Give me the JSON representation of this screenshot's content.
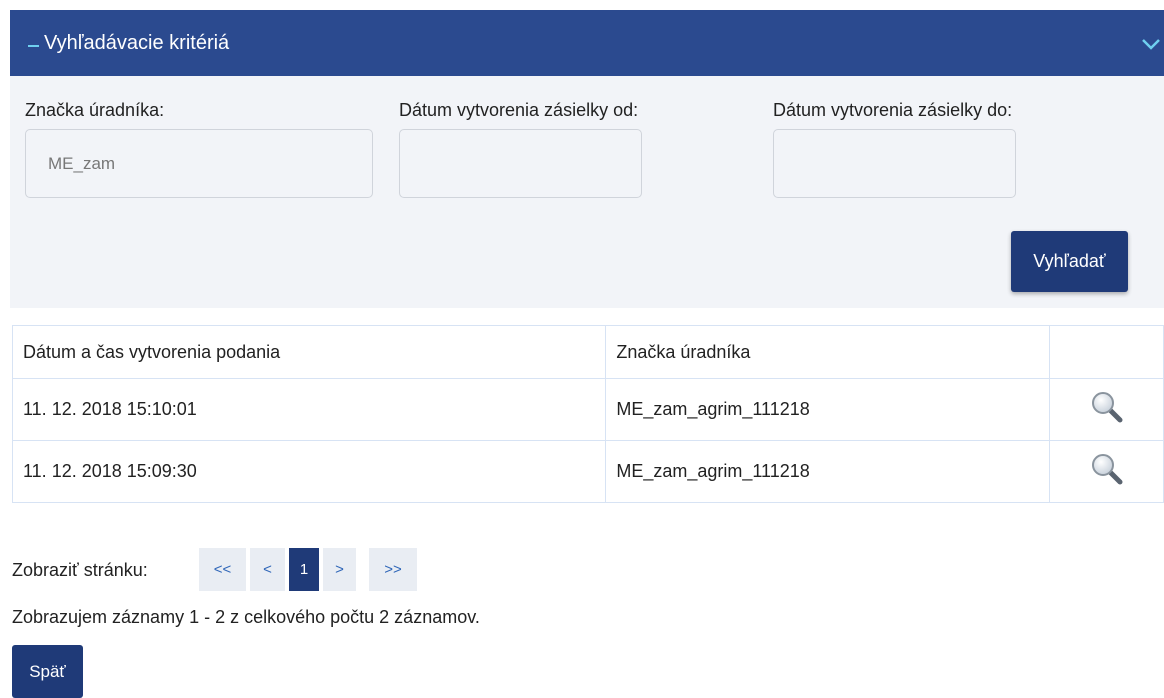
{
  "search_panel": {
    "title": "Vyhľadávacie kritériá",
    "fields": [
      {
        "label": "Značka úradníka:",
        "value": "ME_zam"
      },
      {
        "label": "Dátum vytvorenia zásielky od:",
        "value": ""
      },
      {
        "label": "Dátum vytvorenia zásielky do:",
        "value": ""
      }
    ],
    "search_label": "Vyhľadať"
  },
  "table": {
    "headers": [
      "Dátum a čas vytvorenia podania",
      "Značka úradníka",
      ""
    ],
    "rows": [
      {
        "datetime": "11. 12. 2018 15:10:01",
        "clerk": "ME_zam_agrim_111218"
      },
      {
        "datetime": "11. 12. 2018 15:09:30",
        "clerk": "ME_zam_agrim_111218"
      }
    ]
  },
  "pager": {
    "label": "Zobraziť stránku:",
    "first": "<<",
    "prev": "<",
    "current": "1",
    "next": ">",
    "last": ">>"
  },
  "records_info": "Zobrazujem záznamy 1 - 2 z celkového počtu 2 záznamov.",
  "back_label": "Späť",
  "colors": {
    "header_bg": "#2b4a8f",
    "button_bg": "#1f3a78",
    "panel_bg": "#f2f4f8",
    "accent": "#6fd0f0"
  },
  "icons": {
    "collapse": "minus-icon",
    "toggle": "chevron-down-icon",
    "detail": "magnifier-icon"
  }
}
